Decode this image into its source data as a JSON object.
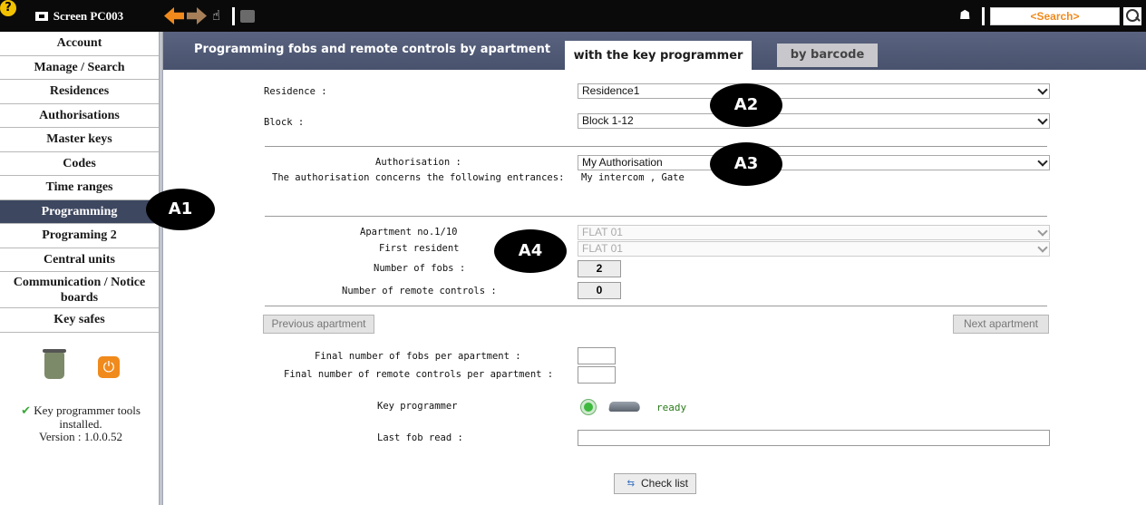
{
  "topbar": {
    "screen_label": "Screen PC003",
    "search_placeholder": "<Search>",
    "icons": [
      "monitor-icon",
      "back-arrow-icon",
      "forward-arrow-icon",
      "hand-pointer-icon",
      "printer-icon",
      "help-icon",
      "profile-icon",
      "search-icon"
    ]
  },
  "sidebar": {
    "items": [
      {
        "label": "Account"
      },
      {
        "label": "Manage / Search"
      },
      {
        "label": "Residences"
      },
      {
        "label": "Authorisations"
      },
      {
        "label": "Master keys"
      },
      {
        "label": "Codes"
      },
      {
        "label": "Time ranges"
      },
      {
        "label": "Programming",
        "active": true
      },
      {
        "label": "Programing 2"
      },
      {
        "label": "Central units"
      },
      {
        "label": "Communication / Notice boards"
      },
      {
        "label": "Key safes"
      }
    ],
    "tools_status_line1": "Key programmer tools installed.",
    "tools_status_line2": "Version : 1.0.0.52"
  },
  "header": {
    "title": "Programming fobs and remote controls by apartment",
    "tab_active": "with the key programmer",
    "tab_inactive": "by barcode"
  },
  "form": {
    "residence_label": "Residence :",
    "residence_value": "Residence1",
    "block_label": "Block :",
    "block_value": "Block 1-12",
    "authorisation_label": "Authorisation :",
    "authorisation_value": "My Authorisation",
    "entrances_label": "The authorisation concerns the following entrances:",
    "entrances_value": "My intercom , Gate",
    "apartment_label": "Apartment no.1/10",
    "apartment_value": "FLAT 01",
    "first_resident_label": "First resident",
    "first_resident_value": "FLAT 01",
    "fobs_label": "Number of fobs :",
    "fobs_value": "2",
    "remotes_label": "Number of remote controls :",
    "remotes_value": "0",
    "prev_button": "Previous apartment",
    "next_button": "Next apartment",
    "final_fobs_label": "Final number of fobs per apartment :",
    "final_remotes_label": "Final number of remote controls per apartment :",
    "key_programmer_label": "Key programmer",
    "key_programmer_status": "ready",
    "last_fob_label": "Last fob read :",
    "check_list_button": "Check list"
  },
  "callouts": {
    "a1": "A1",
    "a2": "A2",
    "a3": "A3",
    "a4": "A4"
  },
  "colors": {
    "header_bg": "#48526d",
    "sidebar_active": "#3d4760",
    "accent_orange": "#f08a1c",
    "status_green": "#3cb93c"
  }
}
